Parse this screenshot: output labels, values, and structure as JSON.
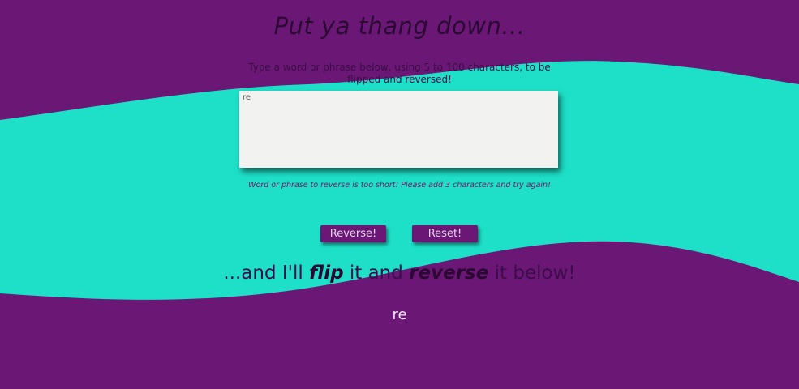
{
  "colors": {
    "background": "#6b1776",
    "wave": "#1ee0c8",
    "textbox": "#f2f2f0",
    "button": "#6b1776"
  },
  "header": {
    "title": "Put ya thang down..."
  },
  "form": {
    "instructions": "Type a word or phrase below, using 5 to 100 characters, to be flipped and reversed!",
    "input_value": "re",
    "error_message": "Word or phrase to reverse is too short! Please add 3 characters and try again!",
    "reverse_label": "Reverse!",
    "reset_label": "Reset!"
  },
  "result": {
    "tagline_prefix": "...and I'll ",
    "tagline_flip": "flip",
    "tagline_middle": " it and ",
    "tagline_reverse": "reverse",
    "tagline_suffix": " it below!",
    "output_text": "re"
  }
}
